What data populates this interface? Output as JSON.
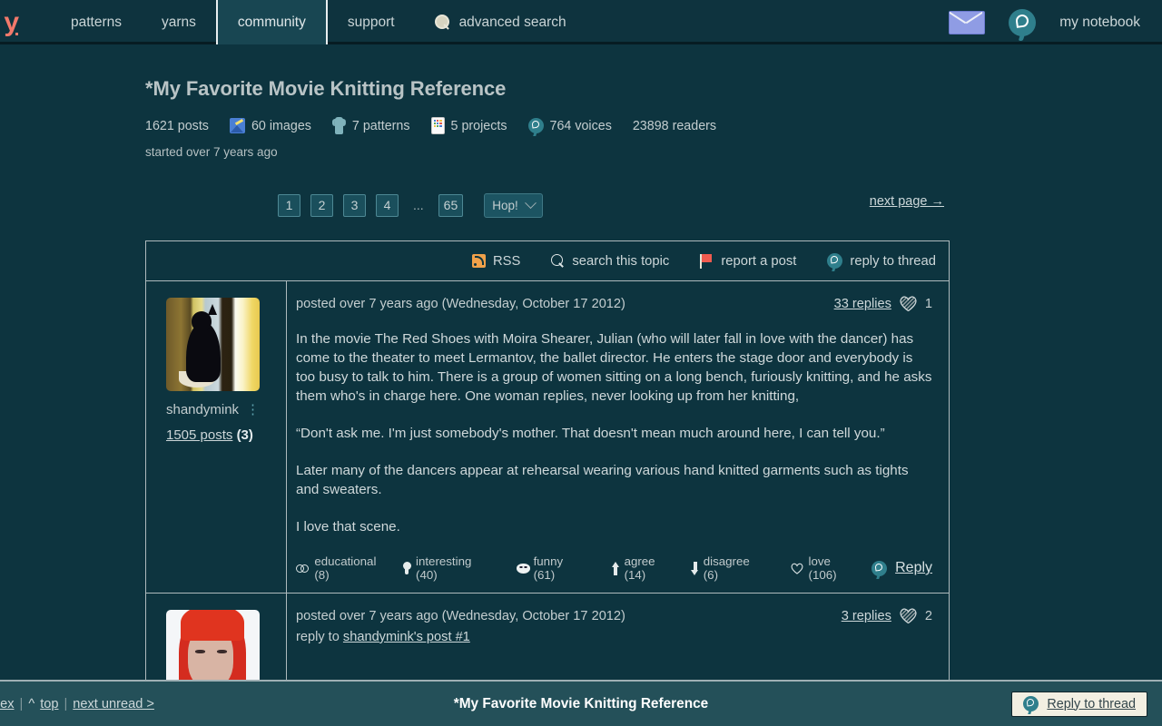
{
  "nav": {
    "logo": "y",
    "tabs": [
      {
        "label": "patterns",
        "active": false
      },
      {
        "label": "yarns",
        "active": false
      },
      {
        "label": "community",
        "active": true
      },
      {
        "label": "support",
        "active": false
      }
    ],
    "advanced_search": "advanced search",
    "messages_icon": "envelope-icon",
    "notifications_icon": "yarn-bubble-icon",
    "notebook": "my notebook"
  },
  "thread": {
    "title": "*My Favorite Movie Knitting Reference",
    "meta": [
      {
        "icon": "",
        "label": "1621 posts"
      },
      {
        "icon": "images-icon",
        "label": "60 images"
      },
      {
        "icon": "sweater-icon",
        "label": "7 patterns"
      },
      {
        "icon": "projects-icon",
        "label": "5 projects"
      },
      {
        "icon": "voices-icon",
        "label": "764 voices"
      },
      {
        "icon": "",
        "label": "23898 readers"
      }
    ],
    "started": "started over 7 years ago"
  },
  "pagination": {
    "pages": [
      "1",
      "2",
      "3",
      "4"
    ],
    "ellipsis": "...",
    "last_page": "65",
    "hop_label": "Hop!",
    "next_page": "next page →"
  },
  "toolbar": {
    "rss": "RSS",
    "search_topic": "search this topic",
    "report": "report a post",
    "reply_thread": "reply to thread"
  },
  "posts": [
    {
      "avatar_type": "cat",
      "username": "shandymink",
      "kebab": "⋮",
      "posts_count": "1505 posts",
      "posts_extra": "(3)",
      "posted": "posted over 7 years ago (Wednesday, October 17 2012)",
      "replies": "33 replies",
      "hearts": "1",
      "paragraphs": [
        "In the movie The Red Shoes with Moira Shearer, Julian (who will later fall in love with the dancer) has come to the theater to meet Lermantov, the ballet director. He enters the stage door and everybody is too busy to talk to him. There is a group of women sitting on a long bench, furiously knitting, and he asks them who's in charge here. One woman replies, never looking up from her knitting,",
        "“Don't ask me. I'm just somebody's mother. That doesn't mean much around here, I can tell you.”",
        "Later many of the dancers appear at rehearsal wearing various hand knitted garments such as tights and sweaters.",
        "I love that scene."
      ],
      "reactions": [
        {
          "icon": "glasses-icon",
          "label": "educational (8)"
        },
        {
          "icon": "lightbulb-icon",
          "label": "interesting (40)"
        },
        {
          "icon": "mask-icon",
          "label": "funny (61)"
        },
        {
          "icon": "arrow-up-icon",
          "label": "agree (14)"
        },
        {
          "icon": "arrow-down-icon",
          "label": "disagree (6)"
        },
        {
          "icon": "heart-outline-icon",
          "label": "love (106)"
        }
      ],
      "reply_label": "Reply"
    },
    {
      "avatar_type": "redhair",
      "posted": "posted over 7 years ago (Wednesday, October 17 2012)",
      "reply_to_prefix": "reply to ",
      "reply_to_link": "shandymink's post #1",
      "replies": "3 replies",
      "hearts": "2"
    }
  ],
  "bottom": {
    "index_link": "dex",
    "sep": "|",
    "caret": "^",
    "top_link": "top",
    "next_unread": "next unread >",
    "title": "*My Favorite Movie Knitting Reference",
    "reply_button": "Reply to thread"
  },
  "colors": {
    "page_bg": "#0d343f",
    "nav_bg": "#0e333e",
    "accent_coral": "#f2796b",
    "teal_badge": "#2f7f8c",
    "border": "#aebabd",
    "bottom_bar": "#245059"
  }
}
